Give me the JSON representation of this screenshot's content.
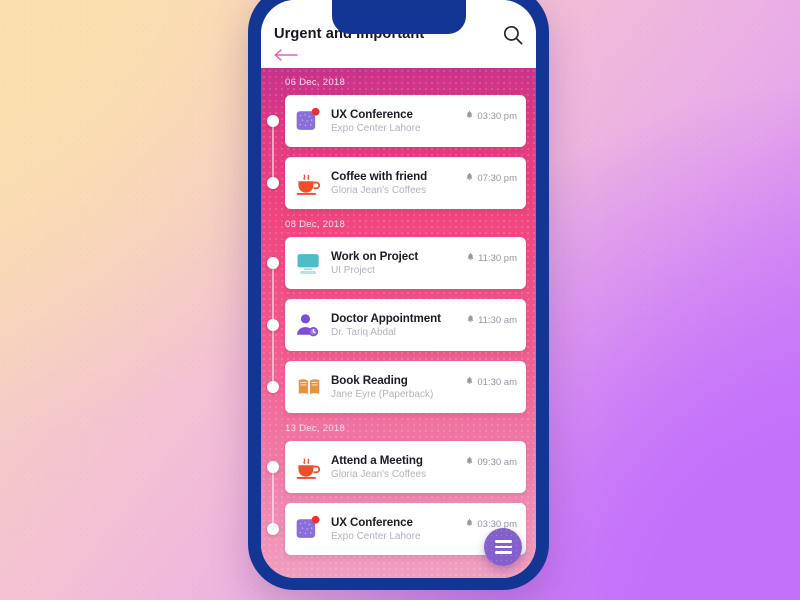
{
  "background": {
    "gradient_from": "#fbe1b2",
    "gradient_mid": "#f2bcd9",
    "gradient_to": "#c573fa"
  },
  "phone": {
    "frame_color": "#133695",
    "notch": "notch"
  },
  "header": {
    "title": "Urgent and Important",
    "search_icon": "search-icon",
    "back_icon": "back-arrow-icon",
    "back_icon_color": "#ee5fa7"
  },
  "fab": {
    "icon": "hamburger-menu-icon",
    "color": "#8460cc"
  },
  "groups": [
    {
      "date": "06 Dec, 2018",
      "events": [
        {
          "title": "UX Conference",
          "subtitle": "Expo Center Lahore",
          "time": "03:30 pm",
          "alarm_icon": "bell-icon",
          "icon": "purple-square-badge-icon",
          "icon_color": "#8a6fdb",
          "badge_color": "#f03030"
        },
        {
          "title": "Coffee with friend",
          "subtitle": "Gloria Jean's Coffees",
          "time": "07:30 pm",
          "alarm_icon": "bell-icon",
          "icon": "coffee-cup-icon",
          "icon_color": "#f04f2a"
        }
      ]
    },
    {
      "date": "08 Dec, 2018",
      "events": [
        {
          "title": "Work on Project",
          "subtitle": "UI Project",
          "time": "11:30 pm",
          "alarm_icon": "bell-icon",
          "icon": "computer-monitor-icon",
          "icon_color": "#4fbec4"
        },
        {
          "title": "Doctor Appointment",
          "subtitle": "Dr. Tariq Abdal",
          "time": "11:30 am",
          "alarm_icon": "bell-icon",
          "icon": "doctor-person-icon",
          "icon_color": "#7b50d6"
        },
        {
          "title": "Book Reading",
          "subtitle": "Jane Eyre (Paperback)",
          "time": "01:30 am",
          "alarm_icon": "bell-icon",
          "icon": "open-book-icon",
          "icon_color": "#e8913f"
        }
      ]
    },
    {
      "date": "13 Dec, 2018",
      "events": [
        {
          "title": "Attend a Meeting",
          "subtitle": "Gloria Jean's Coffees",
          "time": "09:30 am",
          "alarm_icon": "bell-icon",
          "icon": "coffee-cup-icon",
          "icon_color": "#f04f2a"
        },
        {
          "title": "UX Conference",
          "subtitle": "Expo Center Lahore",
          "time": "03:30 pm",
          "alarm_icon": "bell-icon",
          "icon": "purple-square-badge-icon",
          "icon_color": "#8a6fdb",
          "badge_color": "#f03030"
        }
      ]
    }
  ]
}
